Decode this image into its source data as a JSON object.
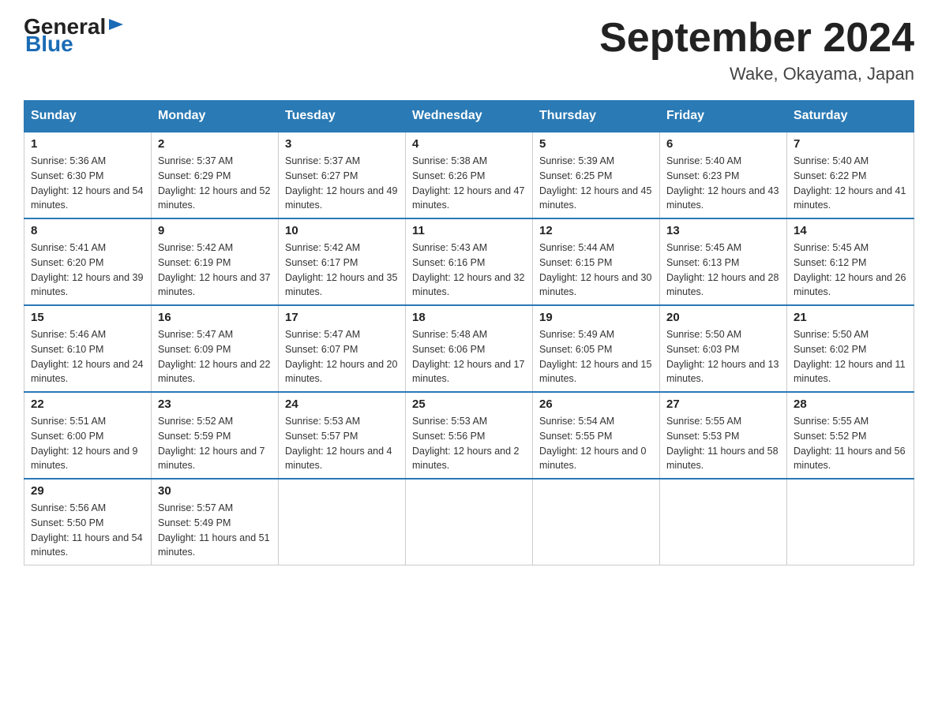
{
  "header": {
    "logo": {
      "general": "General",
      "blue": "Blue"
    },
    "title": "September 2024",
    "subtitle": "Wake, Okayama, Japan"
  },
  "calendar": {
    "days_of_week": [
      "Sunday",
      "Monday",
      "Tuesday",
      "Wednesday",
      "Thursday",
      "Friday",
      "Saturday"
    ],
    "weeks": [
      [
        {
          "day": "1",
          "sunrise": "Sunrise: 5:36 AM",
          "sunset": "Sunset: 6:30 PM",
          "daylight": "Daylight: 12 hours and 54 minutes."
        },
        {
          "day": "2",
          "sunrise": "Sunrise: 5:37 AM",
          "sunset": "Sunset: 6:29 PM",
          "daylight": "Daylight: 12 hours and 52 minutes."
        },
        {
          "day": "3",
          "sunrise": "Sunrise: 5:37 AM",
          "sunset": "Sunset: 6:27 PM",
          "daylight": "Daylight: 12 hours and 49 minutes."
        },
        {
          "day": "4",
          "sunrise": "Sunrise: 5:38 AM",
          "sunset": "Sunset: 6:26 PM",
          "daylight": "Daylight: 12 hours and 47 minutes."
        },
        {
          "day": "5",
          "sunrise": "Sunrise: 5:39 AM",
          "sunset": "Sunset: 6:25 PM",
          "daylight": "Daylight: 12 hours and 45 minutes."
        },
        {
          "day": "6",
          "sunrise": "Sunrise: 5:40 AM",
          "sunset": "Sunset: 6:23 PM",
          "daylight": "Daylight: 12 hours and 43 minutes."
        },
        {
          "day": "7",
          "sunrise": "Sunrise: 5:40 AM",
          "sunset": "Sunset: 6:22 PM",
          "daylight": "Daylight: 12 hours and 41 minutes."
        }
      ],
      [
        {
          "day": "8",
          "sunrise": "Sunrise: 5:41 AM",
          "sunset": "Sunset: 6:20 PM",
          "daylight": "Daylight: 12 hours and 39 minutes."
        },
        {
          "day": "9",
          "sunrise": "Sunrise: 5:42 AM",
          "sunset": "Sunset: 6:19 PM",
          "daylight": "Daylight: 12 hours and 37 minutes."
        },
        {
          "day": "10",
          "sunrise": "Sunrise: 5:42 AM",
          "sunset": "Sunset: 6:17 PM",
          "daylight": "Daylight: 12 hours and 35 minutes."
        },
        {
          "day": "11",
          "sunrise": "Sunrise: 5:43 AM",
          "sunset": "Sunset: 6:16 PM",
          "daylight": "Daylight: 12 hours and 32 minutes."
        },
        {
          "day": "12",
          "sunrise": "Sunrise: 5:44 AM",
          "sunset": "Sunset: 6:15 PM",
          "daylight": "Daylight: 12 hours and 30 minutes."
        },
        {
          "day": "13",
          "sunrise": "Sunrise: 5:45 AM",
          "sunset": "Sunset: 6:13 PM",
          "daylight": "Daylight: 12 hours and 28 minutes."
        },
        {
          "day": "14",
          "sunrise": "Sunrise: 5:45 AM",
          "sunset": "Sunset: 6:12 PM",
          "daylight": "Daylight: 12 hours and 26 minutes."
        }
      ],
      [
        {
          "day": "15",
          "sunrise": "Sunrise: 5:46 AM",
          "sunset": "Sunset: 6:10 PM",
          "daylight": "Daylight: 12 hours and 24 minutes."
        },
        {
          "day": "16",
          "sunrise": "Sunrise: 5:47 AM",
          "sunset": "Sunset: 6:09 PM",
          "daylight": "Daylight: 12 hours and 22 minutes."
        },
        {
          "day": "17",
          "sunrise": "Sunrise: 5:47 AM",
          "sunset": "Sunset: 6:07 PM",
          "daylight": "Daylight: 12 hours and 20 minutes."
        },
        {
          "day": "18",
          "sunrise": "Sunrise: 5:48 AM",
          "sunset": "Sunset: 6:06 PM",
          "daylight": "Daylight: 12 hours and 17 minutes."
        },
        {
          "day": "19",
          "sunrise": "Sunrise: 5:49 AM",
          "sunset": "Sunset: 6:05 PM",
          "daylight": "Daylight: 12 hours and 15 minutes."
        },
        {
          "day": "20",
          "sunrise": "Sunrise: 5:50 AM",
          "sunset": "Sunset: 6:03 PM",
          "daylight": "Daylight: 12 hours and 13 minutes."
        },
        {
          "day": "21",
          "sunrise": "Sunrise: 5:50 AM",
          "sunset": "Sunset: 6:02 PM",
          "daylight": "Daylight: 12 hours and 11 minutes."
        }
      ],
      [
        {
          "day": "22",
          "sunrise": "Sunrise: 5:51 AM",
          "sunset": "Sunset: 6:00 PM",
          "daylight": "Daylight: 12 hours and 9 minutes."
        },
        {
          "day": "23",
          "sunrise": "Sunrise: 5:52 AM",
          "sunset": "Sunset: 5:59 PM",
          "daylight": "Daylight: 12 hours and 7 minutes."
        },
        {
          "day": "24",
          "sunrise": "Sunrise: 5:53 AM",
          "sunset": "Sunset: 5:57 PM",
          "daylight": "Daylight: 12 hours and 4 minutes."
        },
        {
          "day": "25",
          "sunrise": "Sunrise: 5:53 AM",
          "sunset": "Sunset: 5:56 PM",
          "daylight": "Daylight: 12 hours and 2 minutes."
        },
        {
          "day": "26",
          "sunrise": "Sunrise: 5:54 AM",
          "sunset": "Sunset: 5:55 PM",
          "daylight": "Daylight: 12 hours and 0 minutes."
        },
        {
          "day": "27",
          "sunrise": "Sunrise: 5:55 AM",
          "sunset": "Sunset: 5:53 PM",
          "daylight": "Daylight: 11 hours and 58 minutes."
        },
        {
          "day": "28",
          "sunrise": "Sunrise: 5:55 AM",
          "sunset": "Sunset: 5:52 PM",
          "daylight": "Daylight: 11 hours and 56 minutes."
        }
      ],
      [
        {
          "day": "29",
          "sunrise": "Sunrise: 5:56 AM",
          "sunset": "Sunset: 5:50 PM",
          "daylight": "Daylight: 11 hours and 54 minutes."
        },
        {
          "day": "30",
          "sunrise": "Sunrise: 5:57 AM",
          "sunset": "Sunset: 5:49 PM",
          "daylight": "Daylight: 11 hours and 51 minutes."
        },
        null,
        null,
        null,
        null,
        null
      ]
    ]
  }
}
